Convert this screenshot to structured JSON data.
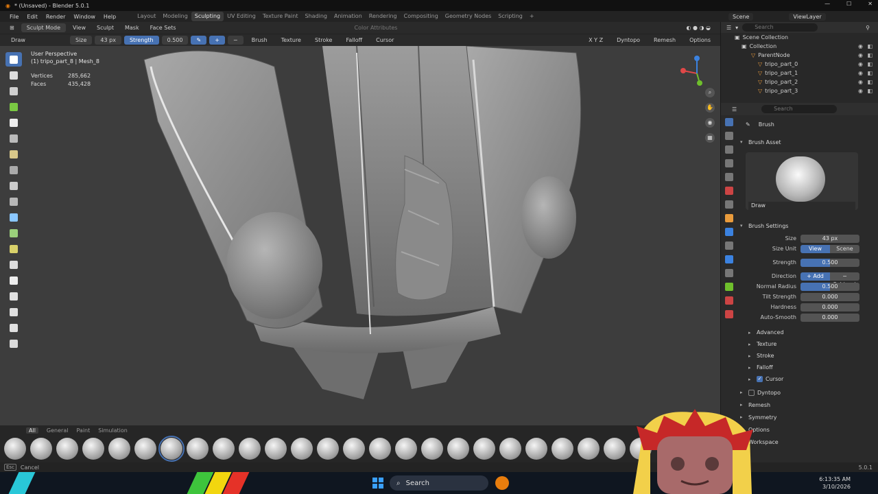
{
  "app": {
    "title": "* (Unsaved) - Blender 5.0.1",
    "menu": [
      "File",
      "Edit",
      "Render",
      "Window",
      "Help"
    ],
    "workspaces": [
      "Layout",
      "Modeling",
      "Sculpting",
      "UV Editing",
      "Texture Paint",
      "Shading",
      "Animation",
      "Rendering",
      "Compositing",
      "Geometry Nodes",
      "Scripting"
    ],
    "active_workspace": "Sculpting",
    "scene": "Scene",
    "view_layer": "ViewLayer"
  },
  "viewport_header": {
    "mode": "Sculpt Mode",
    "items": [
      "View",
      "Sculpt",
      "Mask",
      "Face Sets"
    ],
    "color_attributes": "Color Attributes"
  },
  "tool_header": {
    "tool": "Draw",
    "size_label": "Size",
    "size_value": "43 px",
    "strength_label": "Strength",
    "strength_value": "0.500",
    "menus": [
      "Brush",
      "Texture",
      "Stroke",
      "Falloff",
      "Cursor"
    ],
    "axes": "X Y Z",
    "right": [
      "Dyntopo",
      "Remesh",
      "Options"
    ]
  },
  "viewport": {
    "view_name": "User Perspective",
    "object": "(1) tripo_part_8 | Mesh_8",
    "stats": [
      {
        "label": "Vertices",
        "value": "285,662"
      },
      {
        "label": "Faces",
        "value": "435,428"
      }
    ]
  },
  "outliner": {
    "search_placeholder": "Search",
    "rows": [
      "Scene Collection",
      "Collection",
      "ParentNode",
      "tripo_part_0",
      "tripo_part_1",
      "tripo_part_2",
      "tripo_part_3"
    ]
  },
  "properties": {
    "search_placeholder": "Search",
    "tab_title": "Brush",
    "brush_asset_header": "Brush Asset",
    "brush_name": "Draw",
    "brush_settings_header": "Brush Settings",
    "rows": {
      "size": {
        "label": "Size",
        "value": "43 px"
      },
      "size_unit": {
        "label": "Size Unit",
        "options": [
          "View",
          "Scene"
        ],
        "selected": "View"
      },
      "strength": {
        "label": "Strength",
        "value": "0.500",
        "fraction": 0.5
      },
      "direction": {
        "label": "Direction",
        "options": [
          "+ Add",
          "− Subtract"
        ],
        "selected": "+ Add"
      },
      "normal_radius": {
        "label": "Normal Radius",
        "value": "0.500",
        "fraction": 0.5
      },
      "tilt_strength": {
        "label": "Tilt Strength",
        "value": "0.000",
        "fraction": 0
      },
      "hardness": {
        "label": "Hardness",
        "value": "0.000"
      },
      "auto_smooth": {
        "label": "Auto-Smooth",
        "value": "0.000"
      }
    },
    "subsections": [
      "Advanced",
      "Texture",
      "Stroke",
      "Falloff",
      "Cursor"
    ],
    "panels": [
      "Dyntopo",
      "Remesh",
      "Symmetry",
      "Options",
      "Workspace"
    ]
  },
  "shelf": {
    "tabs": [
      "All",
      "General",
      "Paint",
      "Simulation"
    ],
    "active_tab": "All",
    "brush_count": 25,
    "active_index": 6
  },
  "statusbar": {
    "key": "Esc",
    "action": "Cancel",
    "version": "5.0.1"
  },
  "taskbar": {
    "search": "Search",
    "time": "6:13:35 AM",
    "date": "3/10/2026"
  },
  "colors": {
    "accent": "#4772b3",
    "panel": "#2a2a2a",
    "viewport": "#3d3d3d"
  }
}
